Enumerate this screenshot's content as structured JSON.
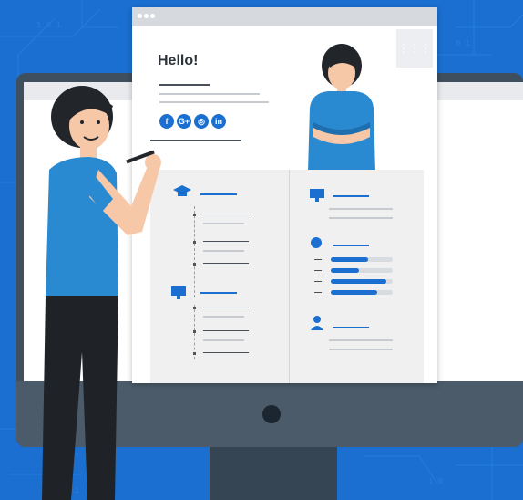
{
  "resume": {
    "greeting": "Hello!",
    "social": [
      {
        "icon": "facebook-icon",
        "glyph": "f"
      },
      {
        "icon": "google-plus-icon",
        "glyph": "G+"
      },
      {
        "icon": "instagram-icon",
        "glyph": "◎"
      },
      {
        "icon": "linkedin-icon",
        "glyph": "in"
      }
    ],
    "skills_levels": [
      0.6,
      0.45,
      0.9,
      0.75
    ]
  },
  "colors": {
    "background": "#1a6fd0",
    "accent": "#1a6fd0",
    "monitor": "#3f4f5e",
    "shirt": "#2a8ad1",
    "pants": "#1f2327"
  }
}
